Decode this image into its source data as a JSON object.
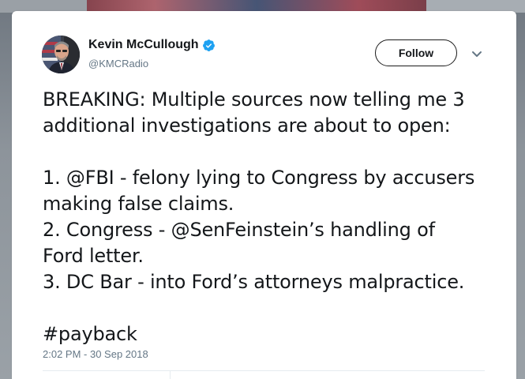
{
  "user": {
    "display_name": "Kevin McCullough",
    "handle": "@KMCRadio",
    "verified": true
  },
  "actions": {
    "follow_label": "Follow"
  },
  "icons": {
    "verified": "verified-badge-icon",
    "caret": "chevron-down-icon"
  },
  "tweet": {
    "lines": [
      "BREAKING: Multiple sources now telling me 3",
      "additional investigations are about to open:",
      "",
      "1. @FBI - felony lying to Congress by accusers",
      "making false claims.",
      "2. Congress - @SenFeinstein’s handling of",
      "Ford letter.",
      "3. DC Bar - into Ford’s attorneys malpractice.",
      "",
      "#payback"
    ],
    "timestamp": "2:02 PM - 30 Sep 2018"
  },
  "colors": {
    "text": "#14171a",
    "secondary": "#657786",
    "verified_blue": "#1da1f2",
    "divider": "#e6ecf0"
  }
}
